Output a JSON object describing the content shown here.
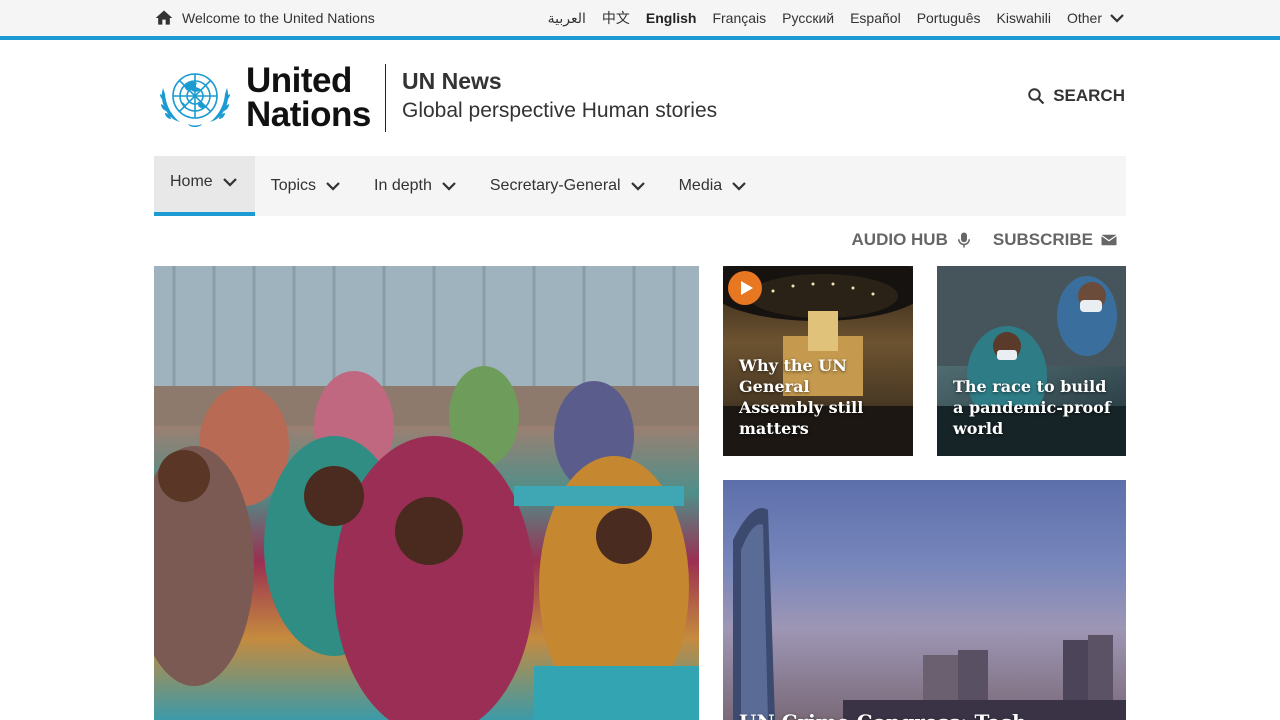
{
  "topbar": {
    "welcome": "Welcome to the United Nations",
    "languages": [
      "العربية",
      "中文",
      "English",
      "Français",
      "Русский",
      "Español",
      "Português",
      "Kiswahili"
    ],
    "active_language": "English",
    "other_label": "Other"
  },
  "header": {
    "wordmark_line1": "United",
    "wordmark_line2": "Nations",
    "site_title": "UN News",
    "tagline": "Global perspective Human stories",
    "search_label": "SEARCH"
  },
  "nav": {
    "items": [
      "Home",
      "Topics",
      "In depth",
      "Secretary-General",
      "Media"
    ],
    "active": "Home"
  },
  "utility": {
    "audio_hub": "AUDIO HUB",
    "subscribe": "SUBSCRIBE"
  },
  "stories": {
    "card1_title": "Why the UN General Assembly still matters",
    "card2_title": "The race to build a pandemic-proof world",
    "card3_title": "UN Crime Congress: Tech, pleasing"
  },
  "colors": {
    "accent": "#1b9bd1",
    "play_button": "#e87722",
    "nav_bg": "#f5f5f5"
  },
  "icons": [
    "home-icon",
    "chevron-down-icon",
    "un-emblem-icon",
    "search-icon",
    "microphone-icon",
    "envelope-icon",
    "play-icon"
  ]
}
